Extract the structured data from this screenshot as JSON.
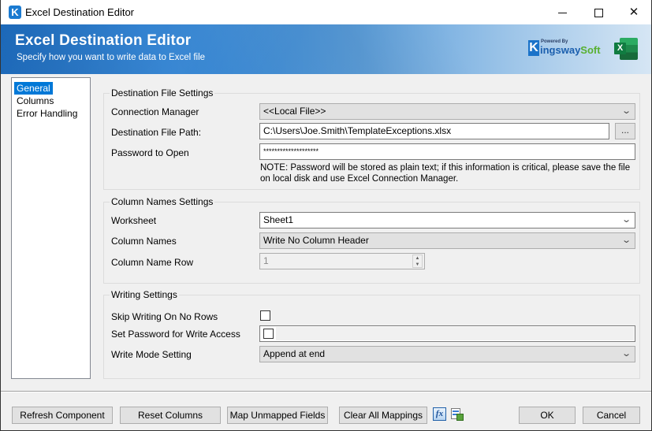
{
  "window": {
    "title": "Excel Destination Editor",
    "icon": "kingswaysoft-k-icon",
    "controls": [
      "minimize",
      "maximize",
      "close"
    ]
  },
  "banner": {
    "title": "Excel Destination Editor",
    "subtitle": "Specify how you want to write data to Excel file",
    "logo_powered_by": "Powered By",
    "logo_k": "K",
    "logo_name_part1": "ingsway",
    "logo_name_part2": "Soft",
    "excel_icon_letter": "X"
  },
  "sidebar": {
    "items": [
      {
        "label": "General",
        "selected": true
      },
      {
        "label": "Columns",
        "selected": false
      },
      {
        "label": "Error Handling",
        "selected": false
      }
    ]
  },
  "destination_file_settings": {
    "legend": "Destination File Settings",
    "connection_manager_label": "Connection Manager",
    "connection_manager_value": "<<Local File>>",
    "file_path_label": "Destination File Path:",
    "file_path_value": "C:\\Users\\Joe.Smith\\TemplateExceptions.xlsx",
    "browse_label": "...",
    "password_label": "Password to Open",
    "password_value": "********************",
    "note": "NOTE: Password will be stored as plain text; if this information is critical, please save the file on local disk and use Excel Connection Manager."
  },
  "column_names_settings": {
    "legend": "Column Names Settings",
    "worksheet_label": "Worksheet",
    "worksheet_value": "Sheet1",
    "column_names_label": "Column Names",
    "column_names_value": "Write No Column Header",
    "column_name_row_label": "Column Name Row",
    "column_name_row_value": "1"
  },
  "writing_settings": {
    "legend": "Writing Settings",
    "skip_writing_label": "Skip Writing On No Rows",
    "skip_writing_checked": false,
    "set_password_label": "Set Password for Write Access",
    "set_password_checked": false,
    "write_mode_label": "Write Mode Setting",
    "write_mode_value": "Append at end"
  },
  "footer": {
    "refresh_label": "Refresh Component",
    "reset_label": "Reset Columns",
    "map_unmapped_label": "Map Unmapped Fields",
    "clear_mappings_label": "Clear All Mappings",
    "fx_icon_text": "fx",
    "ok_label": "OK",
    "cancel_label": "Cancel"
  },
  "colors": {
    "selection": "#0078d7",
    "banner_start": "#1e6fc4",
    "banner_end": "#d6e6f4",
    "excel_green": "#107c41"
  }
}
